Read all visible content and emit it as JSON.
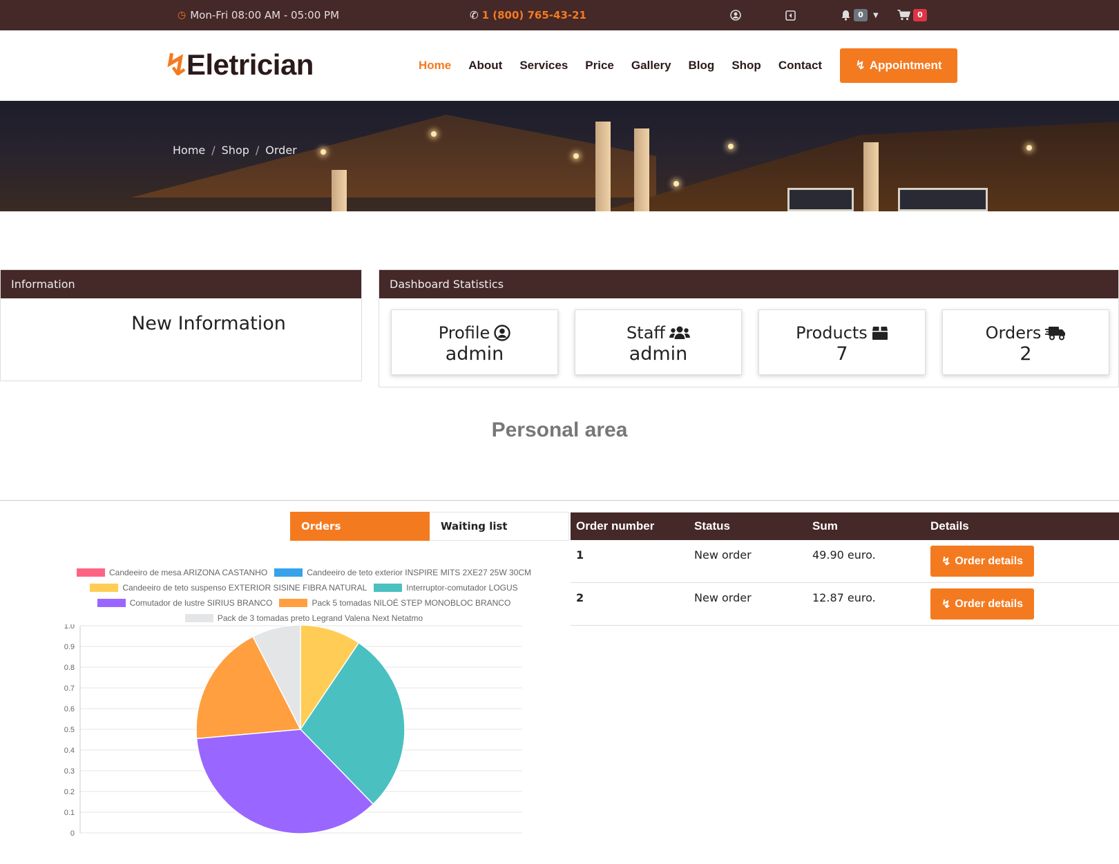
{
  "topbar": {
    "hours": "Mon-Fri 08:00 AM - 05:00 PM",
    "phone": "1 (800) 765-43-21",
    "notifications_count": "0",
    "cart_count": "0",
    "icons": {
      "clock": "clock-icon",
      "phone": "phone-icon",
      "user": "user-circle-icon",
      "logout": "logout-icon",
      "bell": "bell-icon",
      "caret": "caret-down-icon",
      "cart": "cart-icon"
    }
  },
  "navbar": {
    "logo": "Eletrician",
    "menu": [
      "Home",
      "About",
      "Services",
      "Price",
      "Gallery",
      "Blog",
      "Shop",
      "Contact"
    ],
    "active_item": "Home",
    "appointment_label": "Appointment"
  },
  "breadcrumb": [
    "Home",
    "Shop",
    "Order"
  ],
  "information": {
    "header": "Information",
    "body": "New Information"
  },
  "dashboard": {
    "header": "Dashboard Statistics",
    "cards": [
      {
        "label": "Profile",
        "value": "admin",
        "icon": "user-circle-icon"
      },
      {
        "label": "Staff",
        "value": "admin",
        "icon": "users-icon"
      },
      {
        "label": "Products",
        "value": "7",
        "icon": "box-icon"
      },
      {
        "label": "Orders",
        "value": "2",
        "icon": "truck-icon"
      }
    ]
  },
  "personal_area_title": "Personal area",
  "tabs": {
    "orders": "Orders",
    "waiting": "Waiting list",
    "active": "Orders"
  },
  "orders_table": {
    "headers": [
      "Order number",
      "Status",
      "Sum",
      "Details"
    ],
    "rows": [
      {
        "number": "1",
        "status": "New order",
        "sum": "49.90 euro.",
        "button": "Order details"
      },
      {
        "number": "2",
        "status": "New order",
        "sum": "12.87 euro.",
        "button": "Order details"
      }
    ]
  },
  "colors": {
    "brand": "#f47a20",
    "dark": "#452828"
  },
  "chart_data": {
    "type": "pie",
    "categories": [
      "Candeeiro de mesa ARIZONA CASTANHO",
      "Candeeiro de teto exterior INSPIRE MITS 2XE27 25W 30CM",
      "Candeeiro de teto suspenso EXTERIOR SISINE FIBRA NATURAL",
      "Interruptor-comutador LOGUS",
      "Comutador de lustre SIRIUS BRANCO",
      "Pack 5 tomadas NILOÉ STEP MONOBLOC BRANCO",
      "Pack de 3 tomadas preto Legrand Valena Next Netatmo"
    ],
    "values": [
      0,
      0,
      10,
      30,
      38,
      20,
      8
    ],
    "colors": [
      "#ff6384",
      "#36a2eb",
      "#ffcd56",
      "#4bc0c0",
      "#9966ff",
      "#ff9f40",
      "#e4e5e7"
    ],
    "y_ticks": [
      "1.0",
      "0.9",
      "0.8",
      "0.7",
      "0.6",
      "0.5",
      "0.4",
      "0.3",
      "0.2",
      "0.1",
      "0"
    ],
    "ylim": [
      0,
      1
    ],
    "legend_position": "top",
    "grid": true
  }
}
